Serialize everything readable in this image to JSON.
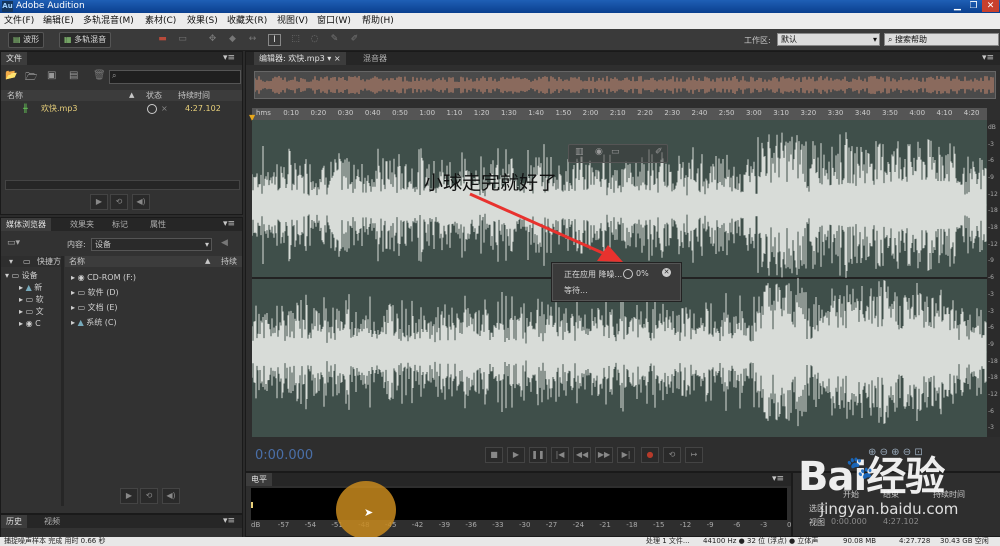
{
  "window": {
    "title": "Adobe Audition",
    "app_icon": "Au"
  },
  "menu": [
    "文件(F)",
    "编辑(E)",
    "多轨混音(M)",
    "素材(C)",
    "效果(S)",
    "收藏夹(R)",
    "视图(V)",
    "窗口(W)",
    "帮助(H)"
  ],
  "toolbar": {
    "waveform": "波形",
    "multitrack": "多轨混音",
    "workspace_label": "工作区:",
    "workspace_value": "默认",
    "search_help": "搜索帮助"
  },
  "files_panel": {
    "tab": "文件",
    "columns": [
      "名称",
      "状态",
      "持续时间"
    ],
    "rows": [
      {
        "name": "欢快.mp3",
        "status": "×",
        "duration": "4:27.102"
      }
    ]
  },
  "browser_panel": {
    "tabs": [
      "媒体浏览器",
      "效果夹",
      "标记",
      "属性"
    ],
    "content_label": "内容:",
    "content_value": "设备",
    "left_tree": [
      "快捷方",
      "设备",
      "新",
      "软",
      "文",
      "C"
    ],
    "list_header": [
      "名称",
      "持续"
    ],
    "drives": [
      "CD-ROM (F:)",
      "软件 (D)",
      "文档 (E)",
      "系统 (C)"
    ]
  },
  "history_panel": {
    "tabs": [
      "历史",
      "视频"
    ]
  },
  "editor": {
    "tabs": [
      "编辑器: 欢快.mp3",
      "混音器"
    ],
    "ruler": [
      "hms",
      "0:10",
      "0:20",
      "0:30",
      "0:40",
      "0:50",
      "1:00",
      "1:10",
      "1:20",
      "1:30",
      "1:40",
      "1:50",
      "2:00",
      "2:10",
      "2:20",
      "2:30",
      "2:40",
      "2:50",
      "3:00",
      "3:10",
      "3:20",
      "3:30",
      "3:40",
      "3:50",
      "4:00",
      "4:10",
      "4:20"
    ],
    "db_scale": [
      "dB",
      "-3",
      "-6",
      "-9",
      "-12",
      "-18",
      "-18",
      "-12",
      "-9",
      "-6",
      "-3",
      "-3",
      "-6",
      "-9",
      "-18",
      "-18",
      "-12",
      "-6",
      "-3"
    ],
    "time": "0:00.000",
    "annotation": "小球走完就好了"
  },
  "progress_dialog": {
    "label": "正在应用 降噪...",
    "percent": "0%",
    "percent_value": 0,
    "waiting": "等待..."
  },
  "level_panel": {
    "tab": "电平",
    "scale": [
      "dB",
      "-57",
      "-54",
      "-51",
      "-48",
      "-45",
      "-42",
      "-39",
      "-36",
      "-33",
      "-30",
      "-27",
      "-24",
      "-21",
      "-18",
      "-15",
      "-12",
      "-9",
      "-6",
      "-3",
      "0"
    ]
  },
  "selection_panel": {
    "headers": [
      "开始",
      "结束",
      "持续时间"
    ],
    "rows": [
      [
        "选区",
        "",
        ""
      ],
      [
        "视图",
        "0:00.000",
        "4:27.102"
      ]
    ]
  },
  "status": {
    "left": "捕捉噪声样本 完成 用时 0.66 秒",
    "items": [
      "处理 1 文件...",
      "44100 Hz ● 32 位 (浮点) ● 立体声",
      "90.08 MB",
      "4:27.728",
      "30.43 GB 空闲"
    ]
  },
  "watermark": {
    "brand": "Bai经验",
    "url": "jingyan.baidu.com"
  },
  "colors": {
    "waveform_bg": "#3f4f4a",
    "waveform": "#d8dcd8",
    "arrow": "#e8322e",
    "cursor_highlight": "#c8891d"
  }
}
